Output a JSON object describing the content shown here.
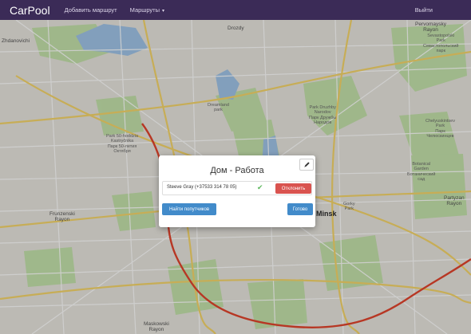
{
  "navbar": {
    "brand": "CarPool",
    "add_route": "Добавить маршрут",
    "routes": "Маршруты",
    "logout": "Выйти"
  },
  "map": {
    "labels": {
      "zhdanovichi": "Zhdanovichi",
      "sevastopol": "Sevastopolski\nPark\nСевастопольский\nпарк",
      "park_druzhby": "Park Druzhby\nNarodov\nПарк Дружбы\nНародов",
      "drozdy": "Drozdy",
      "dreamland": "Dreamland\npark",
      "park50": "Park 50-hoddzia\nKastryčnika\nПарк 50-летия\nОктября",
      "chelyuskintsev": "Chelyuskintsev\nPark\nПарк\nЧелюскинцев",
      "gorky": "Gorky\nPark",
      "botanical": "Botanical\nGarden\nБотанический\nсад",
      "partyzan": "Partyzan\nRayon",
      "frunzenski": "Frunzenski\nRayon",
      "maskowski": "Maskowski\nRayon",
      "minsk": "Minsk",
      "pervomaysky": "Pervomaysky\nRayon"
    }
  },
  "modal": {
    "title": "Дом - Работа",
    "member_name": "Steeve Gray (+37533 314 78 05)",
    "decline_label": "Отклонить",
    "find_label": "Найти попутчиков",
    "done_label": "Готово"
  }
}
